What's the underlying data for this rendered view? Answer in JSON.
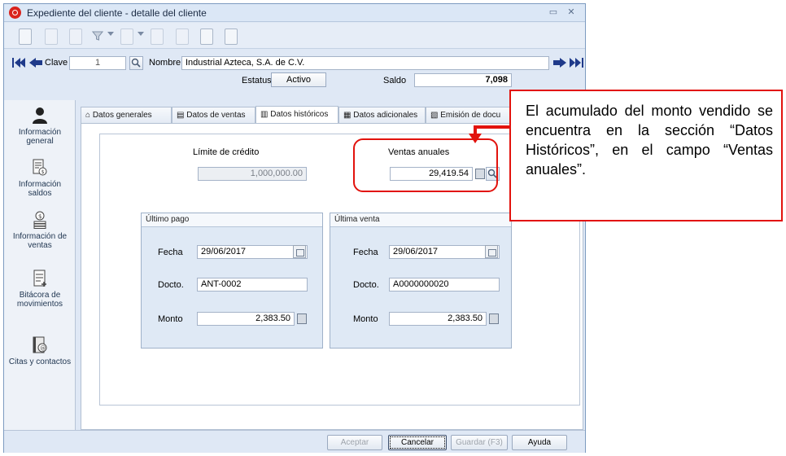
{
  "window": {
    "title": "Expediente del cliente - detalle del cliente",
    "controls": [
      "restore",
      "close"
    ]
  },
  "toolbar": {
    "icons": [
      "nuevo-icon",
      "abrir-icon",
      "documento-icon",
      "filtro-icon",
      "vista-icon",
      "imprimir-icon",
      "reporte-icon",
      "copiar-icon",
      "correo-icon"
    ]
  },
  "record": {
    "clave_label": "Clave",
    "clave_value": "1",
    "nombre_label": "Nombre",
    "nombre_value": "Industrial Azteca, S.A. de C.V.",
    "estatus_label": "Estatus",
    "estatus_value": "Activo",
    "saldo_label": "Saldo",
    "saldo_value": "7,098"
  },
  "sidebar": {
    "items": [
      {
        "label": "Información general",
        "icon": "person-icon"
      },
      {
        "label": "Información saldos",
        "icon": "document-money-icon"
      },
      {
        "label": "Información de ventas",
        "icon": "coins-icon"
      },
      {
        "label": "Bitácora de movimientos",
        "icon": "log-icon"
      },
      {
        "label": "Citas y contactos",
        "icon": "contacts-icon"
      }
    ]
  },
  "tabs": [
    {
      "label": "Datos generales",
      "icon": "home-icon"
    },
    {
      "label": "Datos de ventas",
      "icon": "sales-icon"
    },
    {
      "label": "Datos históricos",
      "icon": "history-icon",
      "active": true
    },
    {
      "label": "Datos adicionales",
      "icon": "extra-data-icon"
    },
    {
      "label": "Emisión de docu",
      "icon": "emission-icon"
    }
  ],
  "historicos": {
    "limite_label": "Límite de crédito",
    "limite_value": "1,000,000.00",
    "ventas_anuales_label": "Ventas anuales",
    "ventas_anuales_value": "29,419.54",
    "ultimo_pago": {
      "title": "Último pago",
      "fecha_label": "Fecha",
      "fecha_value": "29/06/2017",
      "docto_label": "Docto.",
      "docto_value": "ANT-0002",
      "monto_label": "Monto",
      "monto_value": "2,383.50"
    },
    "ultima_venta": {
      "title": "Última venta",
      "fecha_label": "Fecha",
      "fecha_value": "29/06/2017",
      "docto_label": "Docto.",
      "docto_value": "A0000000020",
      "monto_label": "Monto",
      "monto_value": "2,383.50"
    }
  },
  "buttons": {
    "aceptar": "Aceptar",
    "cancelar": "Cancelar",
    "guardar": "Guardar (F3)",
    "ayuda": "Ayuda"
  },
  "callout": {
    "text": "El acumulado del monto vendido se encuentra en la sección “Datos Históricos”, en el campo “Ventas anuales”."
  },
  "colors": {
    "accent_red": "#e2120d",
    "window_bg": "#dfe8f5"
  }
}
